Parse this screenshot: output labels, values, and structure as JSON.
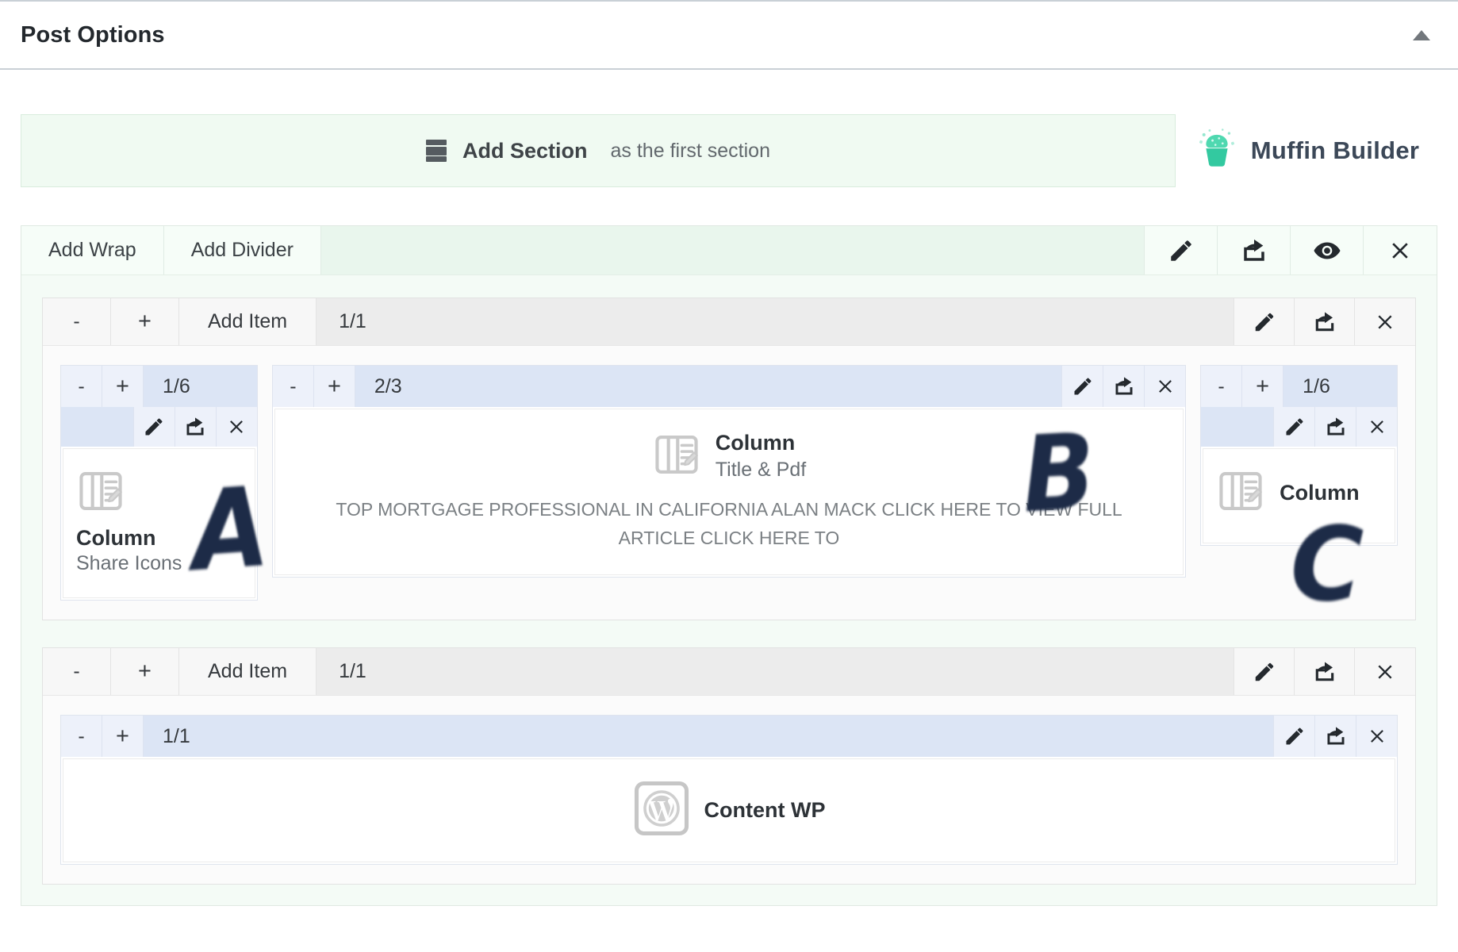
{
  "panel": {
    "title": "Post Options",
    "collapse_icon": "triangle-up-icon"
  },
  "topbar": {
    "add_section_icon": "section-icon",
    "add_section_strong": "Add Section",
    "add_section_light": "as the first section",
    "logo_icon": "cupcake-icon",
    "logo_text": "Muffin Builder"
  },
  "section": {
    "buttons": [
      {
        "label": "Add Wrap",
        "name": "add-wrap-button"
      },
      {
        "label": "Add Divider",
        "name": "add-divider-button"
      }
    ],
    "icons": [
      {
        "name": "edit-pencil-icon"
      },
      {
        "name": "export-icon"
      },
      {
        "name": "eye-visibility-icon"
      },
      {
        "name": "close-x-icon"
      }
    ]
  },
  "wrap1": {
    "minus": "-",
    "plus": "+",
    "add_item": "Add Item",
    "size": "1/1",
    "icons": [
      {
        "name": "edit-pencil-icon"
      },
      {
        "name": "export-icon"
      },
      {
        "name": "close-x-icon"
      }
    ],
    "columns": {
      "left": {
        "minus": "-",
        "plus": "+",
        "size": "1/6",
        "icons": [
          {
            "name": "edit-pencil-icon"
          },
          {
            "name": "export-icon"
          },
          {
            "name": "close-x-icon"
          }
        ],
        "item": {
          "icon": "column-doc-pencil-icon",
          "title": "Column",
          "subtitle": "Share Icons"
        }
      },
      "center": {
        "minus": "-",
        "plus": "+",
        "size": "2/3",
        "icons": [
          {
            "name": "edit-pencil-icon"
          },
          {
            "name": "export-icon"
          },
          {
            "name": "close-x-icon"
          }
        ],
        "item": {
          "icon": "column-doc-pencil-icon",
          "title": "Column",
          "subtitle": "Title & Pdf",
          "description": "TOP MORTGAGE PROFESSIONAL IN CALIFORNIA ALAN MACK CLICK HERE TO VIEW FULL ARTICLE CLICK HERE TO"
        }
      },
      "right": {
        "minus": "-",
        "plus": "+",
        "size": "1/6",
        "icons": [
          {
            "name": "edit-pencil-icon"
          },
          {
            "name": "export-icon"
          },
          {
            "name": "close-x-icon"
          }
        ],
        "item": {
          "icon": "column-doc-pencil-icon",
          "title": "Column"
        }
      }
    }
  },
  "wrap2": {
    "minus": "-",
    "plus": "+",
    "add_item": "Add Item",
    "size": "1/1",
    "icons": [
      {
        "name": "edit-pencil-icon"
      },
      {
        "name": "export-icon"
      },
      {
        "name": "close-x-icon"
      }
    ],
    "column": {
      "minus": "-",
      "plus": "+",
      "size": "1/1",
      "icons": [
        {
          "name": "edit-pencil-icon"
        },
        {
          "name": "export-icon"
        },
        {
          "name": "close-x-icon"
        }
      ],
      "item": {
        "icon": "wordpress-icon",
        "title": "Content WP"
      }
    }
  },
  "annotations": [
    {
      "label": "A",
      "name": "handwritten-annotation-a"
    },
    {
      "label": "B",
      "name": "handwritten-annotation-b"
    },
    {
      "label": "C",
      "name": "handwritten-annotation-c"
    }
  ],
  "colors": {
    "section_green": "#f4fbf6",
    "add_section_green": "#f0faf2",
    "column_blue": "#dce5f5",
    "column_blue_light": "#edf1fa",
    "wrap_grey": "#f7f7f7",
    "annotation_navy": "#1d2b47",
    "logo_teal": "#3fd6ac"
  }
}
